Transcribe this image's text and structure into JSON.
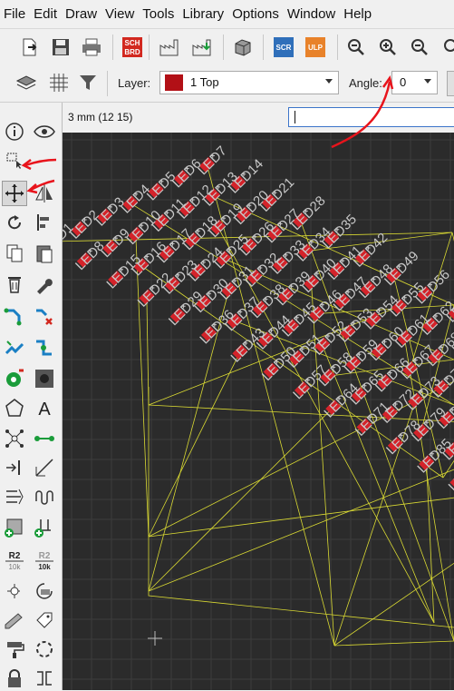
{
  "menu": [
    "File",
    "Edit",
    "Draw",
    "View",
    "Tools",
    "Library",
    "Options",
    "Window",
    "Help"
  ],
  "toolbar": {
    "icons": [
      "open-icon",
      "save-icon",
      "print-icon",
      "sch-brd-icon",
      "cam-icon",
      "manufacturing-icon",
      "3d-icon",
      "scr-icon",
      "ulp-icon",
      "zoom-fit-icon",
      "zoom-in-icon",
      "zoom-out-icon"
    ],
    "sch_text": [
      "SCH",
      "BRD"
    ],
    "scr_text": "SCR",
    "ulp_text": "ULP"
  },
  "params": {
    "layer_label": "Layer:",
    "layer_value": "1 Top",
    "layer_color": "#b21016",
    "angle_label": "Angle:",
    "angle_value": "0"
  },
  "status": {
    "coordinates": "3 mm (12 15)",
    "command_value": ""
  },
  "sidebar": {
    "r2_text": "R2",
    "r2_sub": "10k"
  },
  "canvas": {
    "pad_color": "#d4232a",
    "airwire_color": "#d9d933",
    "label_color": "#c8c8c8",
    "grid_color": "#3c3c3c",
    "label_prefix": "LED"
  },
  "annotation_color": "#e8141c"
}
